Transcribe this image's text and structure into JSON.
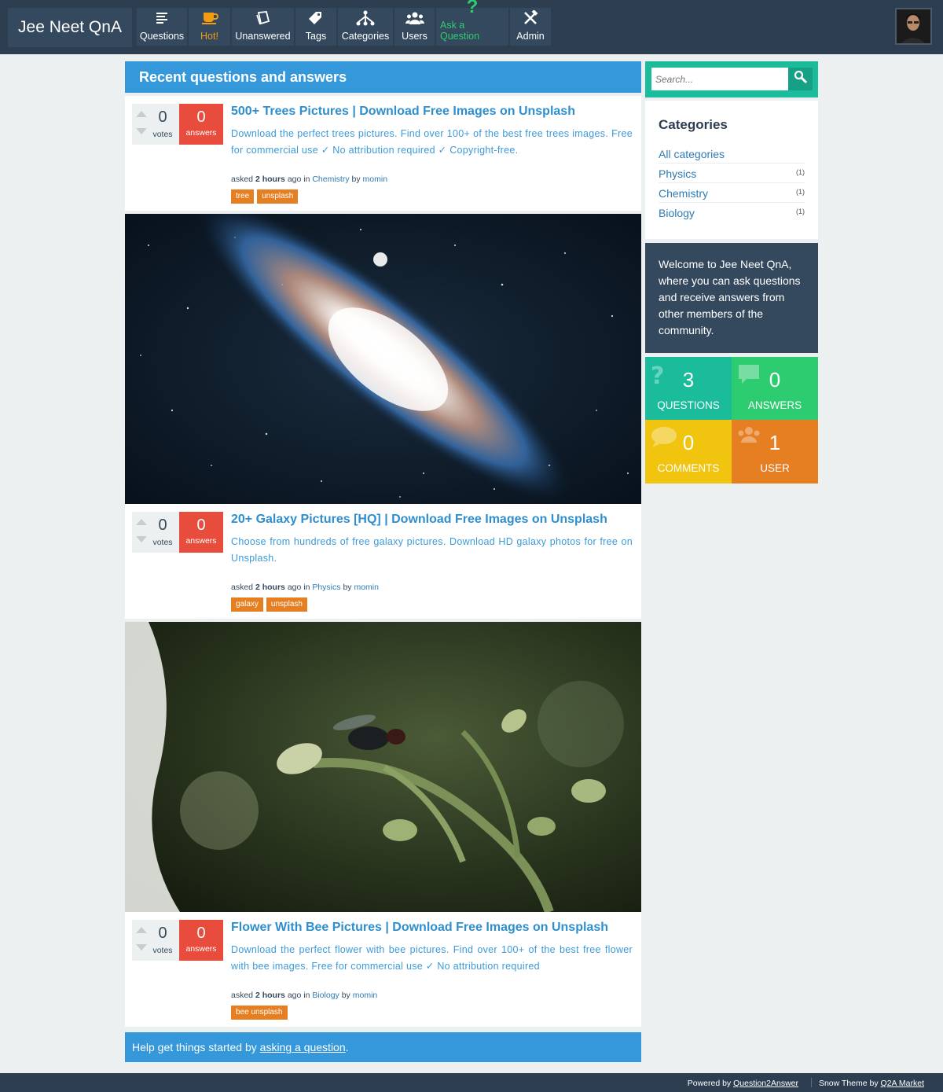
{
  "site": {
    "title": "Jee Neet QnA"
  },
  "nav": [
    {
      "label": "Questions",
      "icon": "questions-icon"
    },
    {
      "label": "Hot!",
      "icon": "hot-icon"
    },
    {
      "label": "Unanswered",
      "icon": "unanswered-icon"
    },
    {
      "label": "Tags",
      "icon": "tags-icon"
    },
    {
      "label": "Categories",
      "icon": "categories-icon"
    },
    {
      "label": "Users",
      "icon": "users-icon"
    },
    {
      "label": "Ask a Question",
      "icon": "ask-question-icon"
    },
    {
      "label": "Admin",
      "icon": "admin-icon"
    }
  ],
  "main": {
    "heading": "Recent questions and answers",
    "questions": [
      {
        "votes": "0",
        "votes_label": "votes",
        "answers": "0",
        "answers_label": "answers",
        "title": "500+ Trees Pictures | Download Free Images on Unsplash",
        "description": "Download the perfect trees pictures. Find over 100+ of the best free trees images. Free for commercial use ✓ No attribution required ✓ Copyright-free.",
        "meta": {
          "asked": "asked",
          "when": "2 hours",
          "ago_in": "ago in",
          "category": "Chemistry",
          "by": "by",
          "user": "momin"
        },
        "tags": [
          "tree",
          "unsplash"
        ]
      },
      {
        "votes": "0",
        "votes_label": "votes",
        "answers": "0",
        "answers_label": "answers",
        "title": "20+ Galaxy Pictures [HQ] | Download Free Images on Unsplash",
        "description": "Choose from hundreds of free galaxy pictures. Download HD galaxy photos for free on Unsplash.",
        "meta": {
          "asked": "asked",
          "when": "2 hours",
          "ago_in": "ago in",
          "category": "Physics",
          "by": "by",
          "user": "momin"
        },
        "tags": [
          "galaxy",
          "unsplash"
        ]
      },
      {
        "votes": "0",
        "votes_label": "votes",
        "answers": "0",
        "answers_label": "answers",
        "title": "Flower With Bee Pictures | Download Free Images on Unsplash",
        "description": "Download the perfect flower with bee pictures. Find over 100+ of the best free flower with bee images. Free for commercial use ✓ No attribution required",
        "meta": {
          "asked": "asked",
          "when": "2 hours",
          "ago_in": "ago in",
          "category": "Biology",
          "by": "by",
          "user": "momin"
        },
        "tags": [
          "bee unsplash"
        ]
      }
    ],
    "help": {
      "prefix": "Help get things started by ",
      "link": "asking a question",
      "suffix": "."
    }
  },
  "sidebar": {
    "search_placeholder": "Search...",
    "categories_title": "Categories",
    "categories": [
      {
        "label": "All categories",
        "count": ""
      },
      {
        "label": "Physics",
        "count": "(1)"
      },
      {
        "label": "Chemistry",
        "count": "(1)"
      },
      {
        "label": "Biology",
        "count": "(1)"
      }
    ],
    "welcome": "Welcome to Jee Neet QnA, where you can ask questions and receive answers from other members of the community.",
    "stats": {
      "questions": {
        "num": "3",
        "label": "QUESTIONS"
      },
      "answers": {
        "num": "0",
        "label": "ANSWERS"
      },
      "comments": {
        "num": "0",
        "label": "COMMENTS"
      },
      "users": {
        "num": "1",
        "label": "USER"
      }
    }
  },
  "footer": {
    "powered_prefix": "Powered by ",
    "powered_link": "Question2Answer",
    "theme_prefix": "Snow Theme by ",
    "theme_link": "Q2A Market"
  },
  "colors": {
    "accent": "#3498db",
    "nav_bg": "#2c3e50",
    "answers_bg": "#e74c3c",
    "tag_bg": "#e67e22",
    "teal": "#1abc9c",
    "green": "#2ecc71",
    "yellow": "#f1c40f"
  }
}
